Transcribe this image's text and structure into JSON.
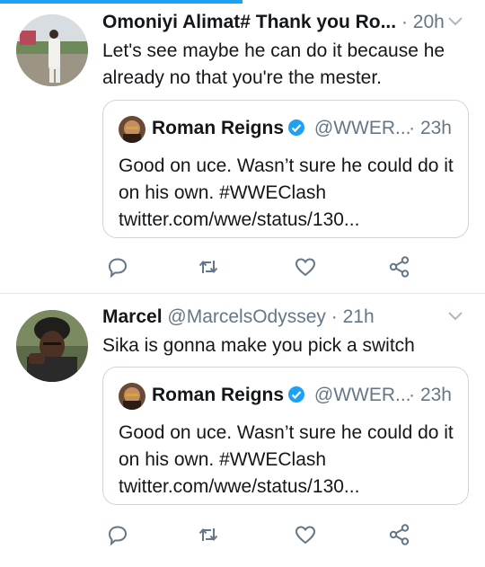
{
  "progress": {
    "fraction": 0.5
  },
  "tweets": [
    {
      "display_name": "Omoniyi Alimat# Thank you Ro...",
      "handle": "",
      "separator": "·",
      "time": "20h",
      "text": "Let's see maybe he can do it because he already no that you're the mester.",
      "quote": {
        "name": "Roman Reigns",
        "handle": "@WWER...",
        "separator": "·",
        "time": "23h",
        "text": "Good on uce. Wasn’t sure he could do it on his own. #WWEClash twitter.com/wwe/status/130..."
      }
    },
    {
      "display_name": "Marcel",
      "handle": "@MarcelsOdyssey",
      "separator": "·",
      "time": "21h",
      "text": "Sika is gonna make you pick a switch",
      "quote": {
        "name": "Roman Reigns",
        "handle": "@WWER...",
        "separator": "·",
        "time": "23h",
        "text": "Good on uce. Wasn’t sure he could do it on his own. #WWEClash twitter.com/wwe/status/130..."
      }
    }
  ],
  "icons": {
    "reply": "reply-icon",
    "retweet": "retweet-icon",
    "like": "like-icon",
    "share": "share-icon",
    "caret": "chevron-down-icon",
    "verified": "verified-badge-icon"
  },
  "colors": {
    "accent": "#1da1f2",
    "text": "#14171a",
    "secondary": "#657786",
    "border": "#ccd6dd",
    "icon": "#657786"
  }
}
